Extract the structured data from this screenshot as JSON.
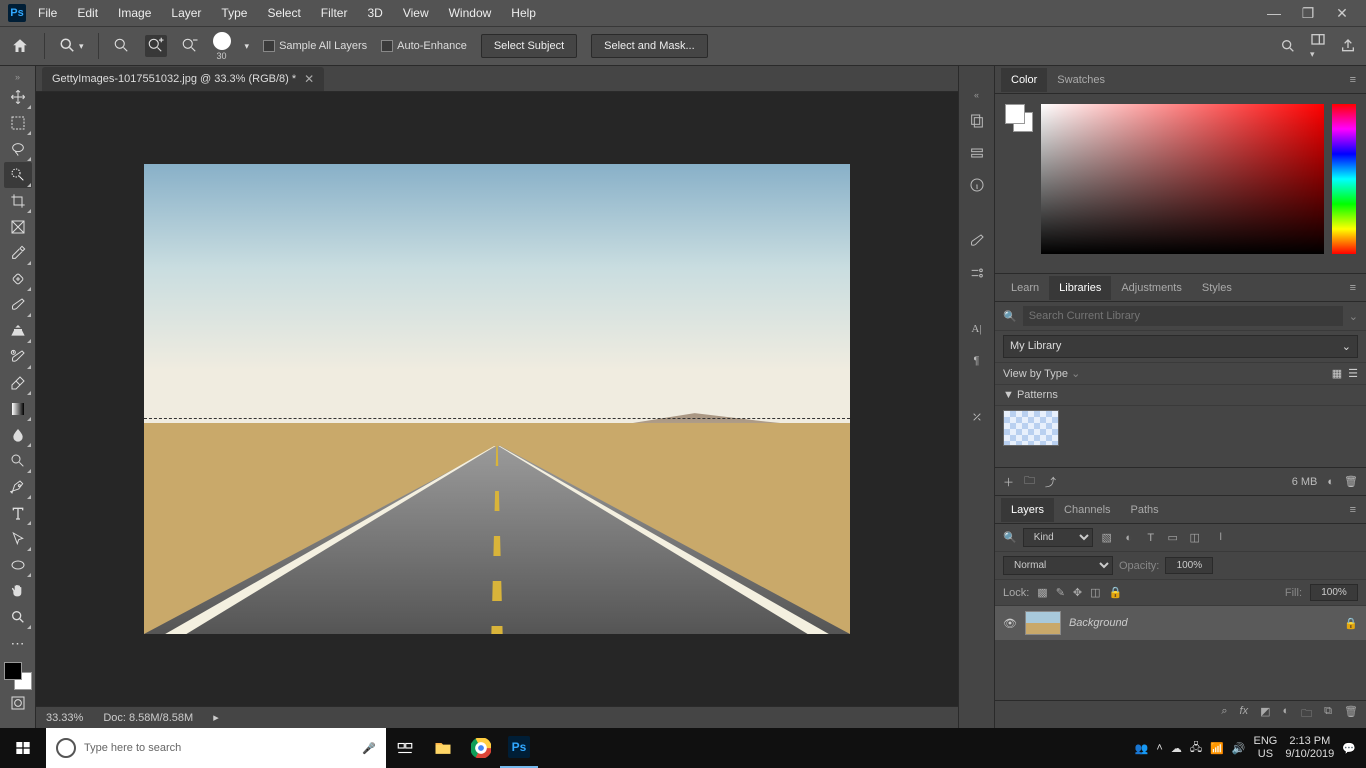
{
  "menu": {
    "items": [
      "File",
      "Edit",
      "Image",
      "Layer",
      "Type",
      "Select",
      "Filter",
      "3D",
      "View",
      "Window",
      "Help"
    ]
  },
  "options": {
    "brush_size": "30",
    "sample_all_layers": "Sample All Layers",
    "auto_enhance": "Auto-Enhance",
    "select_subject": "Select Subject",
    "select_and_mask": "Select and Mask..."
  },
  "document": {
    "tab_title": "GettyImages-1017551032.jpg @ 33.3% (RGB/8) *",
    "zoom": "33.33%",
    "doc_size": "Doc: 8.58M/8.58M"
  },
  "panels": {
    "color_tab": "Color",
    "swatches_tab": "Swatches",
    "learn_tab": "Learn",
    "libraries_tab": "Libraries",
    "adjustments_tab": "Adjustments",
    "styles_tab": "Styles",
    "layers_tab": "Layers",
    "channels_tab": "Channels",
    "paths_tab": "Paths"
  },
  "libraries": {
    "search_placeholder": "Search Current Library",
    "dropdown": "My Library",
    "view_by": "View by Type",
    "section": "Patterns",
    "storage": "6 MB"
  },
  "layers": {
    "filter_kind": "Kind",
    "blend_mode": "Normal",
    "opacity_label": "Opacity:",
    "opacity_value": "100%",
    "lock_label": "Lock:",
    "fill_label": "Fill:",
    "fill_value": "100%",
    "bg_layer": "Background"
  },
  "taskbar": {
    "search_placeholder": "Type here to search",
    "lang1": "ENG",
    "lang2": "US",
    "time": "2:13 PM",
    "date": "9/10/2019"
  }
}
